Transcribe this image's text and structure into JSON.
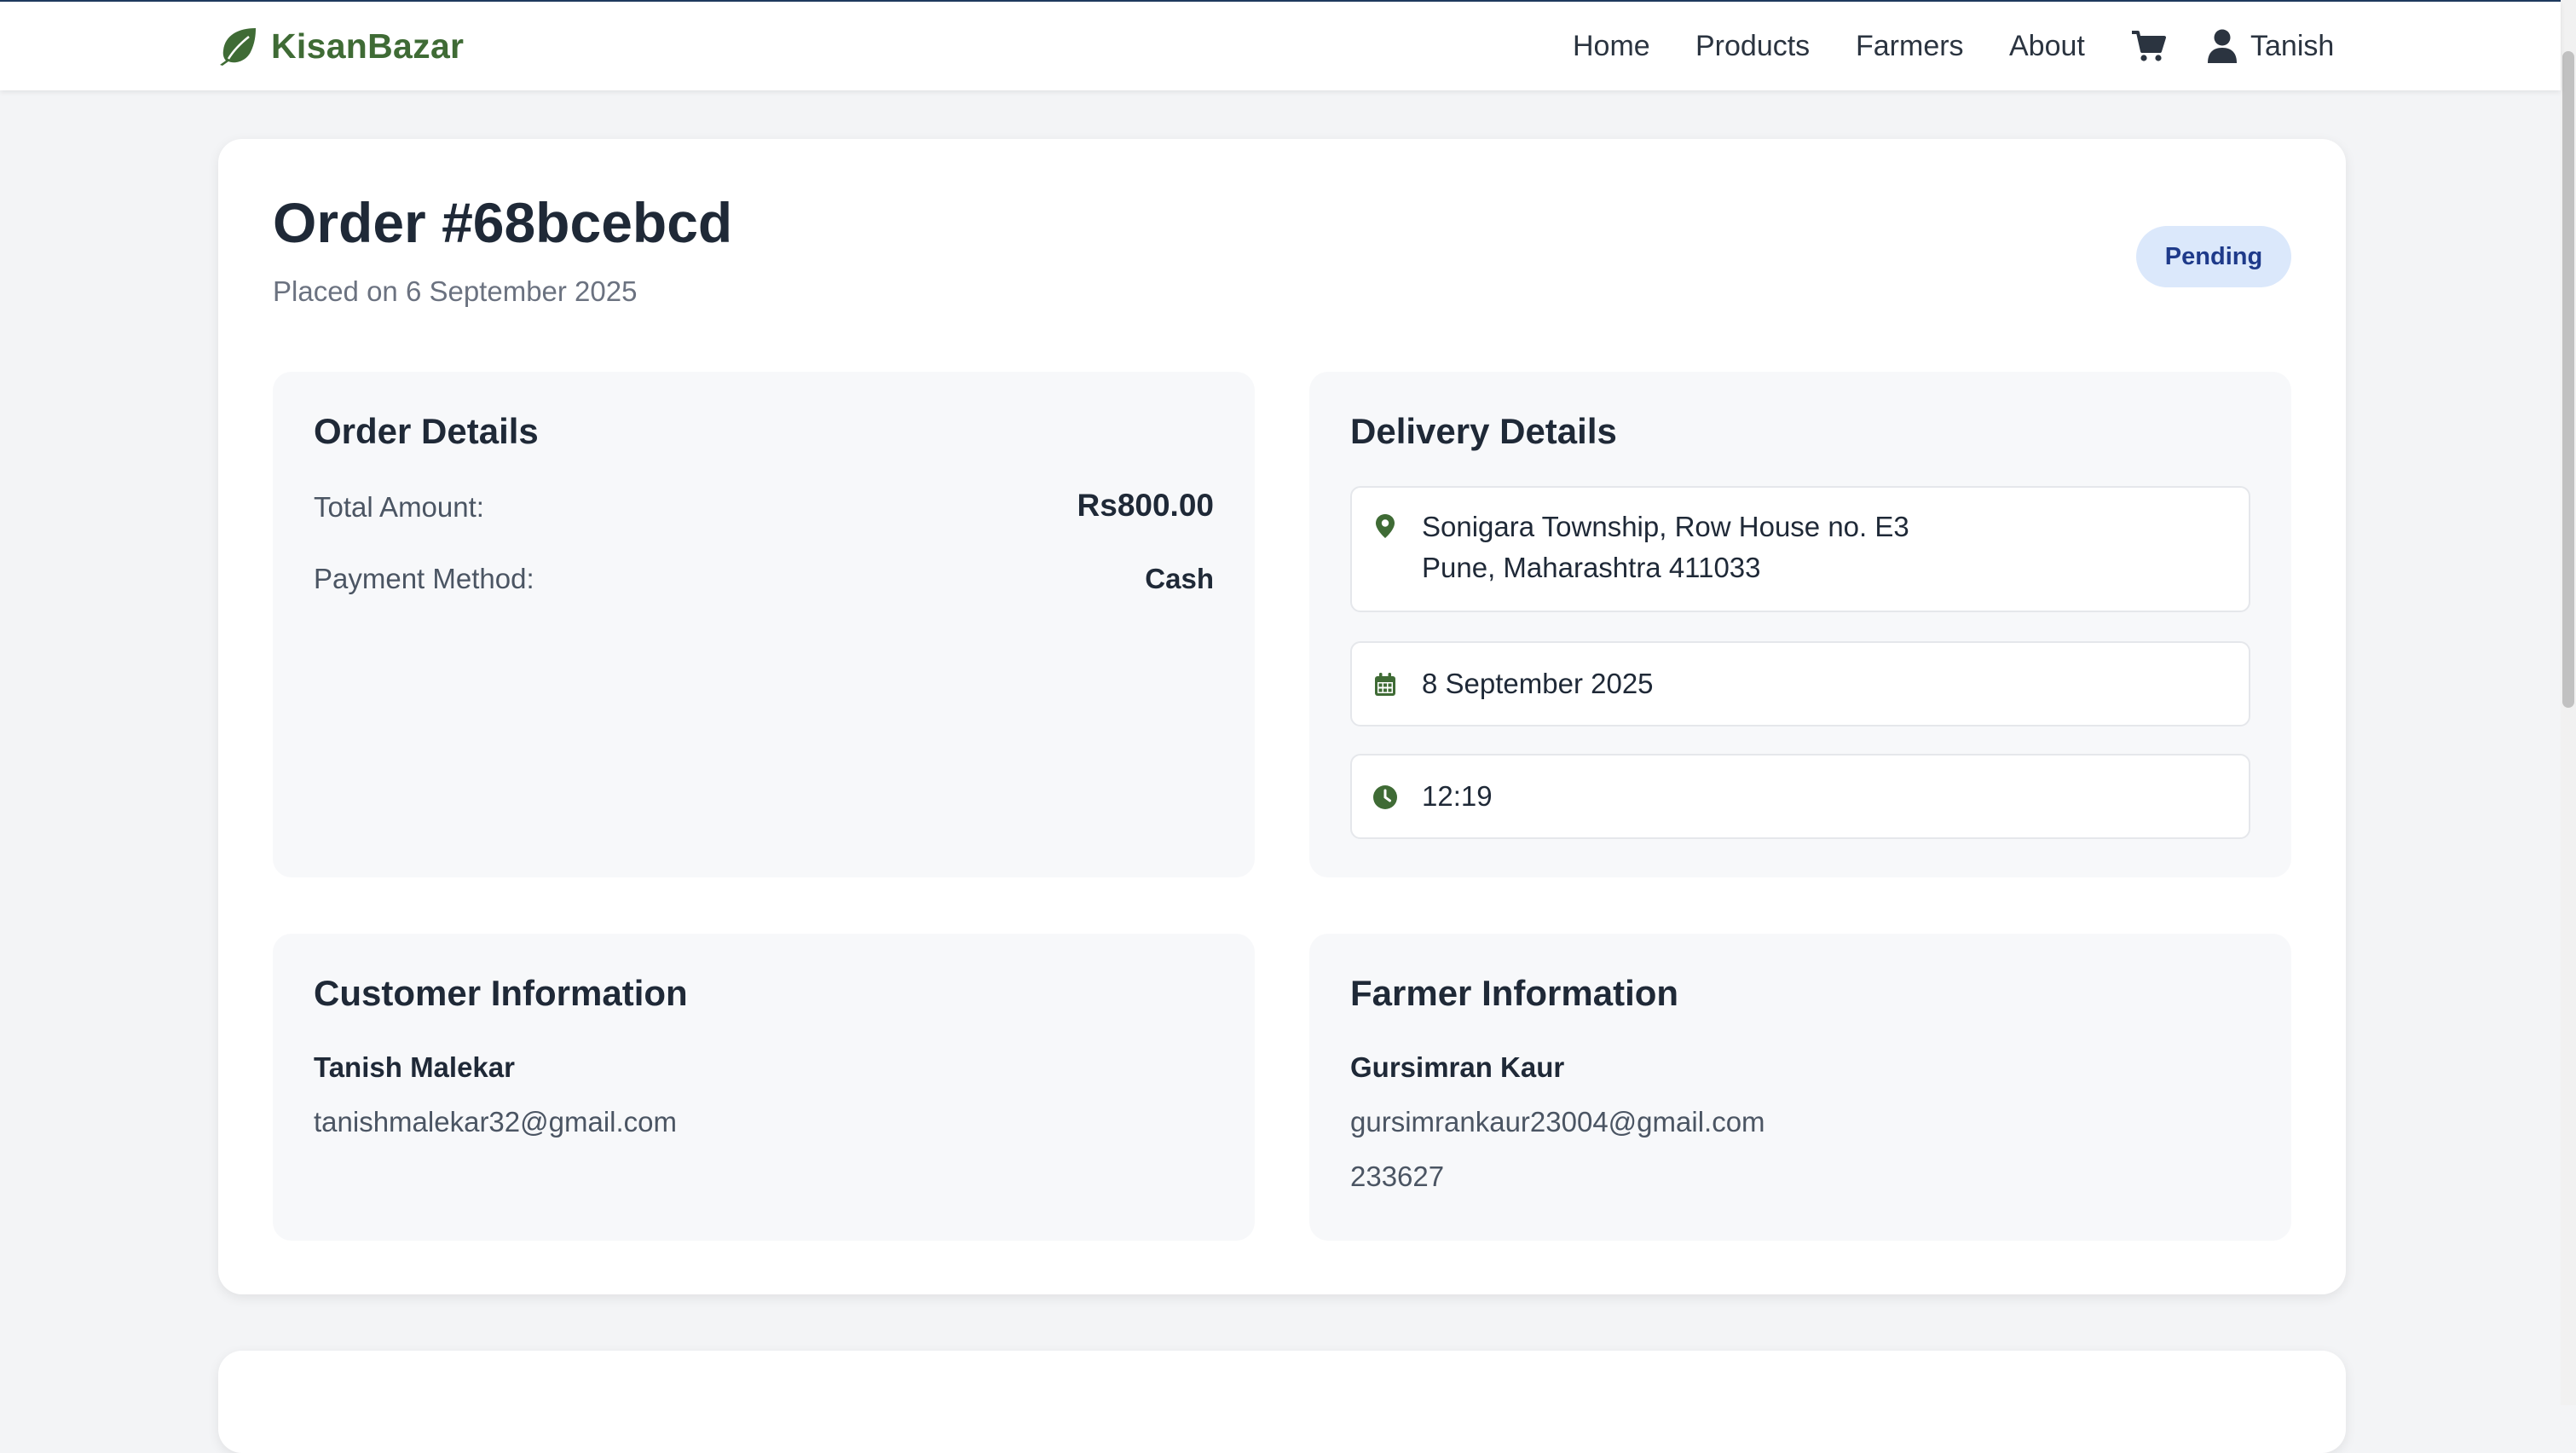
{
  "brand": {
    "name": "KisanBazar",
    "icon": "leaf-icon",
    "color": "#3f6b35"
  },
  "nav": {
    "links": [
      "Home",
      "Products",
      "Farmers",
      "About"
    ],
    "cart_icon": "cart-icon",
    "user_icon": "user-icon",
    "user_name": "Tanish"
  },
  "order": {
    "title": "Order #68bcebcd",
    "placed_on": "Placed on 6 September 2025",
    "status": "Pending"
  },
  "order_details": {
    "title": "Order Details",
    "total_label": "Total Amount:",
    "total_value": "Rs800.00",
    "payment_label": "Payment Method:",
    "payment_value": "Cash"
  },
  "delivery_details": {
    "title": "Delivery Details",
    "address_line1": "Sonigara Township, Row House no. E3",
    "address_line2": "Pune, Maharashtra 411033",
    "date": "8 September 2025",
    "time": "12:19",
    "icons": [
      "location-pin-icon",
      "calendar-icon",
      "clock-icon"
    ]
  },
  "customer": {
    "title": "Customer Information",
    "name": "Tanish Malekar",
    "email": "tanishmalekar32@gmail.com"
  },
  "farmer": {
    "title": "Farmer Information",
    "name": "Gursimran Kaur",
    "email": "gursimrankaur23004@gmail.com",
    "phone": "233627"
  },
  "colors": {
    "accent_green": "#3f6b35",
    "badge_bg": "#dbe8fb",
    "badge_text": "#1e3a8a",
    "page_bg": "#f3f4f6"
  }
}
